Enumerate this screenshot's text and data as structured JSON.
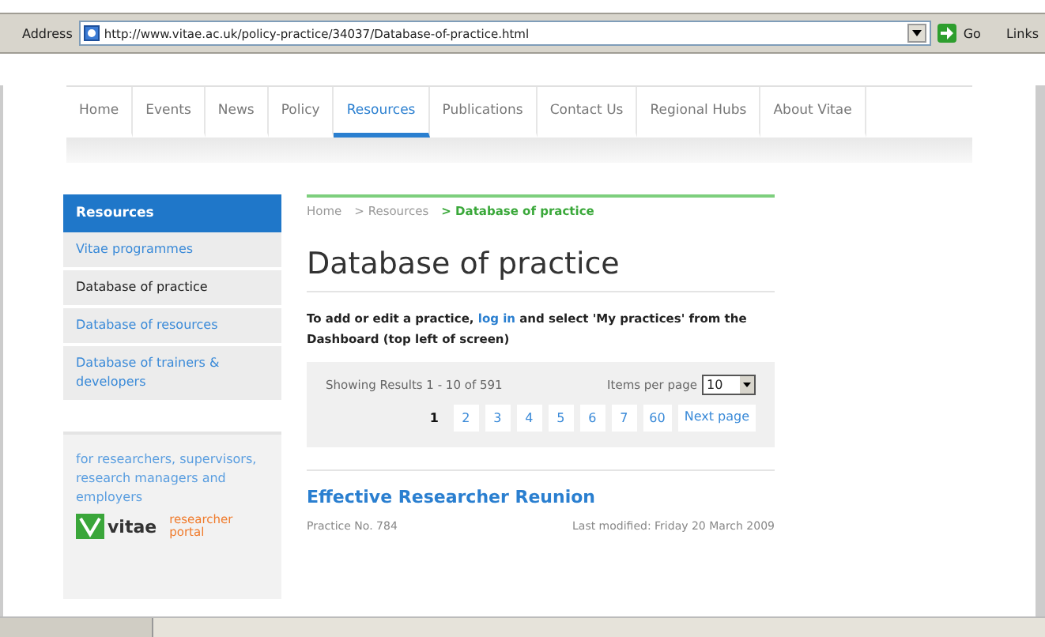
{
  "address_bar": {
    "label": "Address",
    "url": "http://www.vitae.ac.uk/policy-practice/34037/Database-of-practice.html",
    "go": "Go",
    "links": "Links"
  },
  "nav": [
    {
      "label": "Home",
      "selected": false
    },
    {
      "label": "Events",
      "selected": false
    },
    {
      "label": "News",
      "selected": false
    },
    {
      "label": "Policy",
      "selected": false
    },
    {
      "label": "Resources",
      "selected": true
    },
    {
      "label": "Publications",
      "selected": false
    },
    {
      "label": "Contact Us",
      "selected": false
    },
    {
      "label": "Regional Hubs",
      "selected": false
    },
    {
      "label": "About Vitae",
      "selected": false
    }
  ],
  "sidebar": {
    "title": "Resources",
    "items": [
      {
        "label": "Vitae programmes",
        "selected": false
      },
      {
        "label": "Database of practice",
        "selected": true
      },
      {
        "label": "Database of resources",
        "selected": false
      },
      {
        "label": "Database of trainers & developers",
        "selected": false
      }
    ],
    "promo": {
      "text": "for researchers, supervisors, research managers and employers",
      "logo": "vitae",
      "portal": "researcher portal"
    }
  },
  "breadcrumb": [
    "Home",
    "> Resources",
    "> Database of practice"
  ],
  "title": "Database of practice",
  "intro": {
    "before": "To add or edit a practice, ",
    "link": "log in",
    "after": " and select 'My practices' from the Dashboard (top left of screen)"
  },
  "results": {
    "showing": "Showing Results 1 - 10 of 591",
    "per_page_label": "Items per page",
    "per_page": "10",
    "pages": [
      {
        "label": "1",
        "selected": true
      },
      {
        "label": "2",
        "selected": false
      },
      {
        "label": "3",
        "selected": false
      },
      {
        "label": "4",
        "selected": false
      },
      {
        "label": "5",
        "selected": false
      },
      {
        "label": "6",
        "selected": false
      },
      {
        "label": "7",
        "selected": false
      },
      {
        "label": "60",
        "selected": false
      }
    ],
    "next": "Next page"
  },
  "entry": {
    "title": "Effective Researcher Reunion",
    "number": "Practice No. 784",
    "modified": "Last modified: Friday 20 March 2009"
  }
}
